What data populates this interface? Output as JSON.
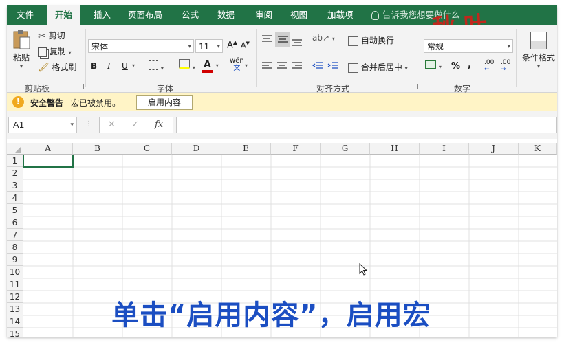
{
  "tabs": [
    "文件",
    "开始",
    "插入",
    "页面布局",
    "公式",
    "数据",
    "审阅",
    "视图",
    "加载项"
  ],
  "tell_me": "告诉我您想要做什么",
  "logo_text": "秋叶",
  "clipboard": {
    "paste": "粘贴",
    "cut": "剪切",
    "copy": "复制",
    "format_painter": "格式刷",
    "group_label": "剪贴板"
  },
  "font": {
    "name": "宋体",
    "size": "11",
    "bold": "B",
    "italic": "I",
    "underline": "U",
    "phonetic": "wén",
    "group_label": "字体"
  },
  "alignment": {
    "wrap_text": "自动换行",
    "merge_center": "合并后居中",
    "group_label": "对齐方式"
  },
  "number": {
    "format": "常规",
    "percent": "%",
    "comma": ",",
    "inc_decimal": ".00",
    "dec_decimal": ".00",
    "group_label": "数字"
  },
  "styles": {
    "conditional_format": "条件格式"
  },
  "security": {
    "title": "安全警告",
    "message": "宏已被禁用。",
    "enable_button": "启用内容"
  },
  "formula_bar": {
    "cell_ref": "A1",
    "cancel": "✕",
    "confirm": "✓",
    "fx": "fx",
    "value": ""
  },
  "columns": [
    "A",
    "B",
    "C",
    "D",
    "E",
    "F",
    "G",
    "H",
    "I",
    "J",
    "K"
  ],
  "rows": [
    "1",
    "2",
    "3",
    "4",
    "5",
    "6",
    "7",
    "8",
    "9",
    "10",
    "11",
    "12",
    "13",
    "14",
    "15"
  ],
  "caption": "单击“启用内容”，启用宏",
  "colors": {
    "accent": "#217346",
    "security_bar": "#fff4c6",
    "caption": "#1b4ec2",
    "logo": "#c0281d"
  }
}
